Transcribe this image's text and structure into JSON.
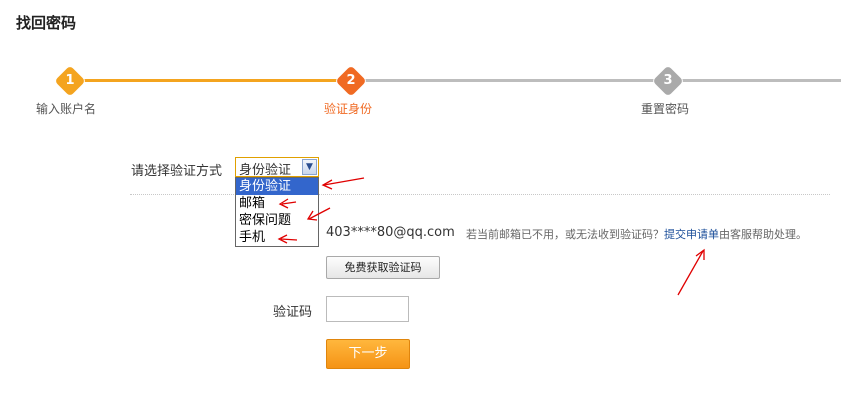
{
  "page": {
    "title": "找回密码"
  },
  "steps": [
    {
      "number": "1",
      "label": "输入账户名",
      "state": "done",
      "color": "#f4a41f"
    },
    {
      "number": "2",
      "label": "验证身份",
      "state": "current",
      "color": "#f06a23"
    },
    {
      "number": "3",
      "label": "重置密码",
      "state": "todo",
      "color": "#aaaaaa"
    }
  ],
  "verify": {
    "method_label": "请选择验证方式",
    "selected": "身份验证",
    "options": [
      "身份验证",
      "邮箱",
      "密保问题",
      "手机"
    ]
  },
  "email": {
    "address": "403****80@qq.com",
    "hint_prefix": "若当前邮箱已不用，或无法收到验证码？",
    "hint_link": "提交申请单",
    "hint_suffix": "由客服帮助处理。"
  },
  "buttons": {
    "get_code": "免费获取验证码",
    "next": "下一步"
  },
  "code": {
    "label": "验证码",
    "value": ""
  },
  "colors": {
    "accent": "#f4a41f",
    "link": "#1a4d99",
    "annotation": "#e00000"
  }
}
